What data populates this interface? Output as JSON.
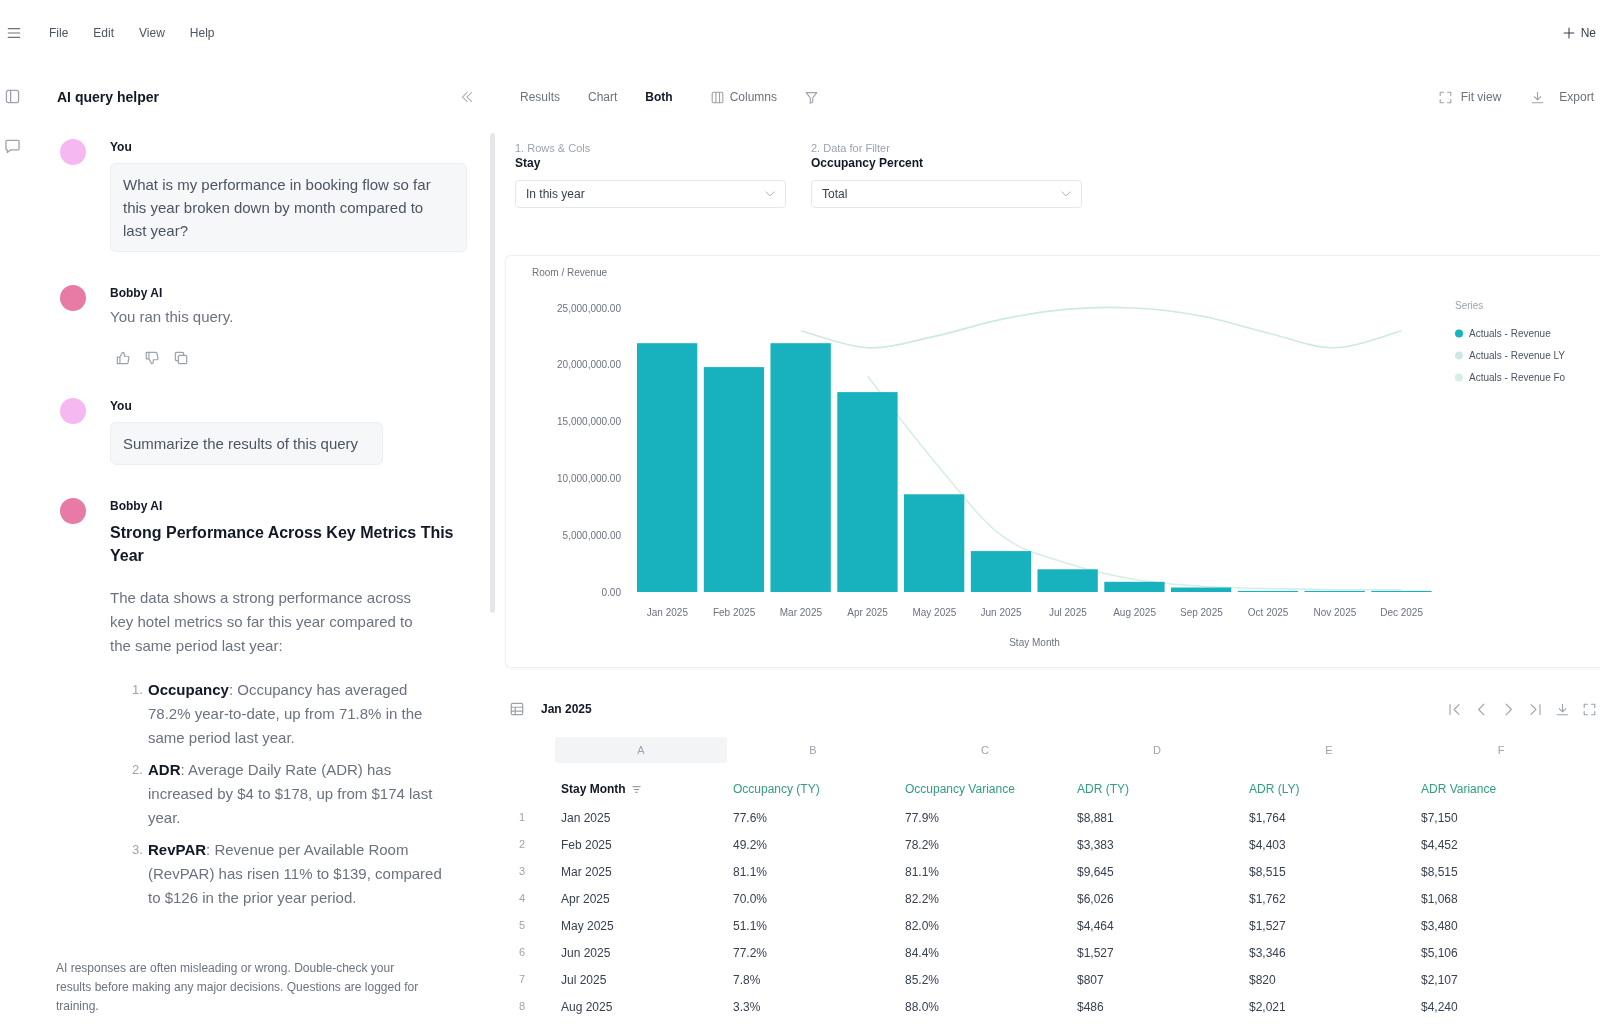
{
  "menu_bar": {
    "items": [
      {
        "label": "File"
      },
      {
        "label": "Edit"
      },
      {
        "label": "View"
      },
      {
        "label": "Help"
      }
    ],
    "new_button": "Ne"
  },
  "assistant_panel": {
    "title": "AI query helper",
    "messages": [
      {
        "kind": "user",
        "author": "You",
        "text": "What is my performance in booking flow so far this year broken down by month compared to last year?",
        "actions": false
      },
      {
        "kind": "assistant",
        "author": "Bobby AI",
        "text": "You ran this query.",
        "actions": true
      },
      {
        "kind": "user",
        "author": "You",
        "text": "Summarize the results of this query",
        "actions": false
      },
      {
        "kind": "assistant",
        "author": "Bobby AI",
        "heading": "Strong Performance Across Key Metrics This Year",
        "text": "The data shows a strong performance across key hotel metrics so far this year compared to the same period last year:",
        "list": [
          {
            "marker": "1.",
            "text": "**Occupancy**: Occupancy has averaged 78.2% year-to-date, up from 71.8% in the same period last year."
          },
          {
            "marker": "2.",
            "text": "**ADR**: Average Daily Rate (ADR) has increased by $4 to $178, up from $174 last year."
          },
          {
            "marker": "3.",
            "text": "**RevPAR**: Revenue per Available Room (RevPAR) has risen 11% to $139, compared to $126 in the prior year period."
          }
        ],
        "actions": false
      }
    ],
    "disclaimer": "AI responses are often misleading or wrong. Double-check your results before making any major decisions. Questions are logged for training."
  },
  "toolbar": {
    "view_tabs": [
      {
        "label": "Results",
        "selected": false
      },
      {
        "label": "Chart",
        "selected": false
      },
      {
        "label": "Both",
        "selected": true
      }
    ],
    "columns_button": "Columns",
    "fit_button": "Fit view",
    "export_button": "Export"
  },
  "filters": [
    {
      "step": "1. Rows & Cols",
      "label": "Stay",
      "value": "In this year"
    },
    {
      "step": "2. Data for Filter",
      "label": "Occupancy Percent",
      "value": "Total"
    }
  ],
  "chart": {
    "chart_data": {
      "type": "bar",
      "ylabel": "Room / Revenue",
      "xlabel": "Stay Month",
      "categories": [
        "Jan 2025",
        "Feb 2025",
        "Mar 2025",
        "Apr 2025",
        "May 2025",
        "Jun 2025",
        "Jul 2025",
        "Aug 2025",
        "Sep 2025",
        "Oct 2025",
        "Nov 2025",
        "Dec 2025"
      ],
      "series": [
        {
          "name": "Actuals - Revenue",
          "type": "bar",
          "color": "#17b2bd",
          "values": [
            21900000,
            19800000,
            21900000,
            17600000,
            8600000,
            3600000,
            2000000,
            900000,
            400000,
            100000,
            100000,
            100000
          ]
        },
        {
          "name": "Actuals - Revenue LY",
          "type": "line",
          "color": "#cde9e6",
          "values": [
            null,
            null,
            23000000,
            21500000,
            22500000,
            24000000,
            24900000,
            25000000,
            24300000,
            22800000,
            21500000,
            23000000
          ]
        },
        {
          "name": "Actuals - Revenue Fo",
          "type": "line",
          "color": "#d6ede8",
          "values": [
            null,
            null,
            null,
            19000000,
            11500000,
            5000000,
            2500000,
            1100000,
            500000,
            300000,
            200000,
            200000
          ]
        }
      ],
      "ylim": [
        0,
        25000000
      ],
      "yticks": [
        {
          "value": 0,
          "label": "0.00"
        },
        {
          "value": 5000000,
          "label": "5,000,000.00"
        },
        {
          "value": 10000000,
          "label": "10,000,000.00"
        },
        {
          "value": 15000000,
          "label": "15,000,000.00"
        },
        {
          "value": 20000000,
          "label": "20,000,000.00"
        },
        {
          "value": 25000000,
          "label": "25,000,000.00"
        }
      ],
      "legend": {
        "title": "Series"
      }
    }
  },
  "table": {
    "title": "Jan 2025",
    "column_letters": [
      {
        "label": "A",
        "selected": true
      },
      {
        "label": "B",
        "selected": false
      },
      {
        "label": "C",
        "selected": false
      },
      {
        "label": "D",
        "selected": false
      },
      {
        "label": "E",
        "selected": false
      },
      {
        "label": "F",
        "selected": false
      }
    ],
    "columns": [
      {
        "label": "Stay Month",
        "kind": "dimension"
      },
      {
        "label": "Occupancy (TY)",
        "kind": "measure"
      },
      {
        "label": "Occupancy Variance",
        "kind": "measure"
      },
      {
        "label": "ADR (TY)",
        "kind": "measure"
      },
      {
        "label": "ADR (LY)",
        "kind": "measure"
      },
      {
        "label": "ADR Variance",
        "kind": "measure"
      }
    ],
    "rows": [
      {
        "number": "1",
        "cells": [
          "Jan 2025",
          "77.6%",
          "77.9%",
          "$8,881",
          "$1,764",
          "$7,150"
        ]
      },
      {
        "number": "2",
        "cells": [
          "Feb 2025",
          "49.2%",
          "78.2%",
          "$3,383",
          "$4,403",
          "$4,452"
        ]
      },
      {
        "number": "3",
        "cells": [
          "Mar 2025",
          "81.1%",
          "81.1%",
          "$9,645",
          "$8,515",
          "$8,515"
        ]
      },
      {
        "number": "4",
        "cells": [
          "Apr 2025",
          "70.0%",
          "82.2%",
          "$6,026",
          "$1,762",
          "$1,068"
        ]
      },
      {
        "number": "5",
        "cells": [
          "May 2025",
          "51.1%",
          "82.0%",
          "$4,464",
          "$1,527",
          "$3,480"
        ]
      },
      {
        "number": "6",
        "cells": [
          "Jun 2025",
          "77.2%",
          "84.4%",
          "$1,527",
          "$3,346",
          "$5,106"
        ]
      },
      {
        "number": "7",
        "cells": [
          "Jul 2025",
          "7.8%",
          "85.2%",
          "$807",
          "$820",
          "$2,107"
        ]
      },
      {
        "number": "8",
        "cells": [
          "Aug 2025",
          "3.3%",
          "88.0%",
          "$486",
          "$2,021",
          "$4,240"
        ]
      }
    ]
  }
}
